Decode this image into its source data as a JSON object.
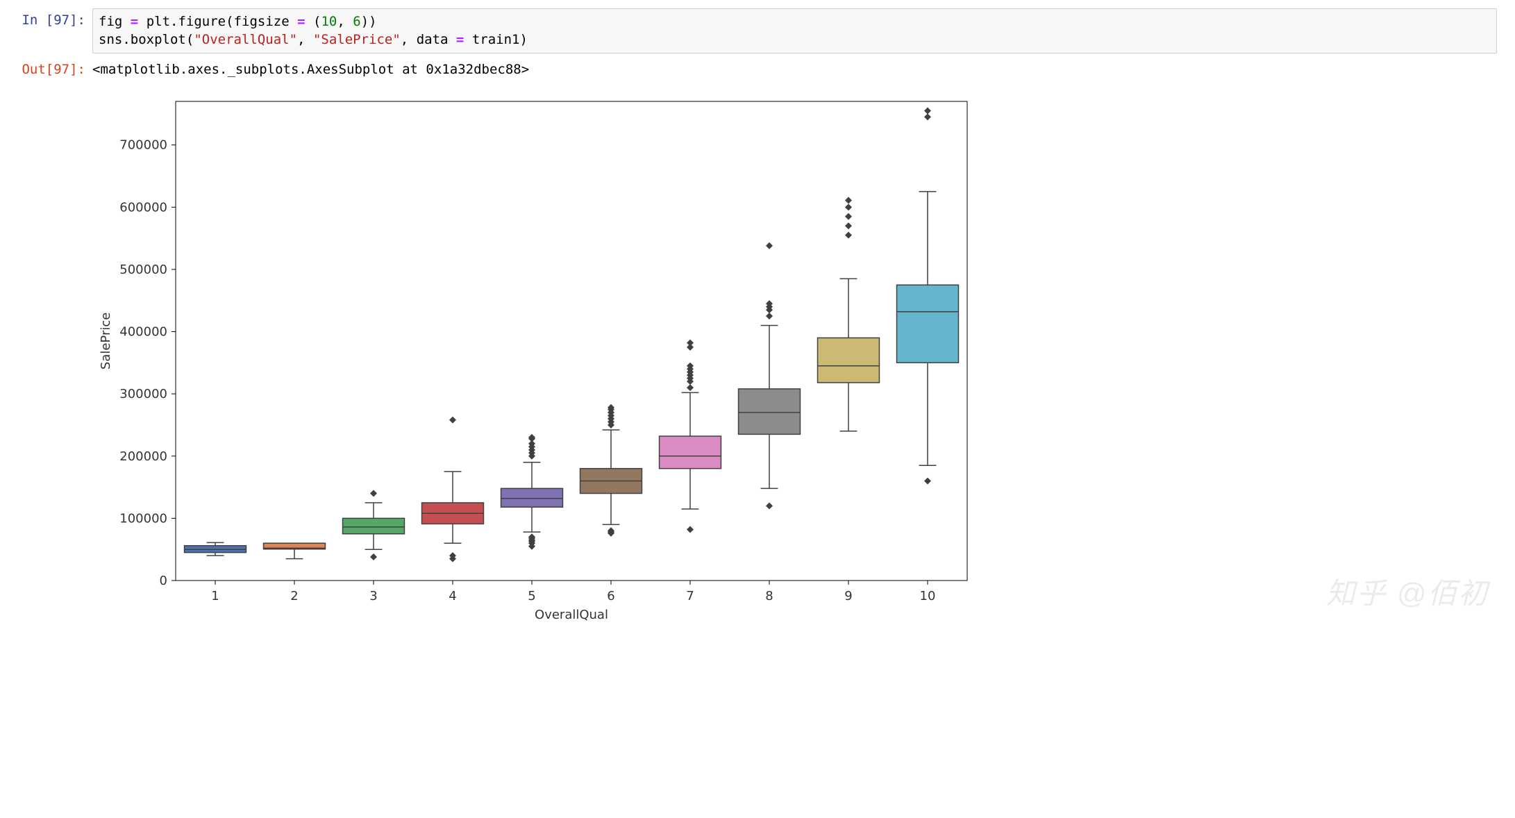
{
  "input_prompt": "In [97]:",
  "output_prompt": "Out[97]:",
  "code_line1_tokens": {
    "fig": "fig",
    "eq": "=",
    "plt": "plt",
    "dot1": ".",
    "figure": "figure",
    "lp": "(",
    "figsize": "figsize",
    "eq2": "=",
    "lp2": "(",
    "ten": "10",
    "comma": ",",
    "six": "6",
    "rp2": ")",
    "rp": ")"
  },
  "code_line2_tokens": {
    "sns": "sns",
    "dot": ".",
    "boxplot": "boxplot",
    "lp": "(",
    "s1": "\"OverallQual\"",
    "comma1": ",",
    "s2": "\"SalePrice\"",
    "comma2": ",",
    "data": "data",
    "eq": "=",
    "train": "train1",
    "rp": ")"
  },
  "output_text": "<matplotlib.axes._subplots.AxesSubplot at 0x1a32dbec88>",
  "watermark": "知乎 @佰初",
  "chart_data": {
    "type": "box",
    "xlabel": "OverallQual",
    "ylabel": "SalePrice",
    "categories": [
      "1",
      "2",
      "3",
      "4",
      "5",
      "6",
      "7",
      "8",
      "9",
      "10"
    ],
    "ylim": [
      0,
      770000
    ],
    "yticks": [
      0,
      100000,
      200000,
      300000,
      400000,
      500000,
      600000,
      700000
    ],
    "ytick_labels": [
      "0",
      "100000",
      "200000",
      "300000",
      "400000",
      "500000",
      "600000",
      "700000"
    ],
    "series": [
      {
        "cat": "1",
        "color": "#4c72b0",
        "q1": 45000,
        "median": 50000,
        "q3": 56000,
        "wlo": 40000,
        "whi": 61000,
        "outliers": []
      },
      {
        "cat": "2",
        "color": "#dd8452",
        "q1": 50500,
        "median": 52000,
        "q3": 60000,
        "wlo": 35000,
        "whi": 60000,
        "outliers": []
      },
      {
        "cat": "3",
        "color": "#55a868",
        "q1": 75000,
        "median": 86000,
        "q3": 100000,
        "wlo": 50000,
        "whi": 125000,
        "outliers": [
          38000,
          140000
        ]
      },
      {
        "cat": "4",
        "color": "#c44e52",
        "q1": 91000,
        "median": 108000,
        "q3": 125000,
        "wlo": 60000,
        "whi": 175000,
        "outliers": [
          35000,
          40000,
          258000
        ]
      },
      {
        "cat": "5",
        "color": "#8172b3",
        "q1": 118000,
        "median": 132000,
        "q3": 148000,
        "wlo": 78000,
        "whi": 190000,
        "outliers": [
          55000,
          60000,
          63000,
          65000,
          68000,
          70000,
          200000,
          205000,
          210000,
          215000,
          220000,
          228000,
          230000
        ]
      },
      {
        "cat": "6",
        "color": "#937860",
        "q1": 140000,
        "median": 160000,
        "q3": 180000,
        "wlo": 90000,
        "whi": 242000,
        "outliers": [
          76000,
          78000,
          80000,
          250000,
          255000,
          260000,
          265000,
          270000,
          275000,
          278000
        ]
      },
      {
        "cat": "7",
        "color": "#da8bc3",
        "q1": 180000,
        "median": 200000,
        "q3": 232000,
        "wlo": 115000,
        "whi": 302000,
        "outliers": [
          82000,
          310000,
          320000,
          325000,
          330000,
          335000,
          340000,
          345000,
          375000,
          382000
        ]
      },
      {
        "cat": "8",
        "color": "#8c8c8c",
        "q1": 235000,
        "median": 270000,
        "q3": 308000,
        "wlo": 148000,
        "whi": 410000,
        "outliers": [
          120000,
          425000,
          435000,
          440000,
          445000,
          538000
        ]
      },
      {
        "cat": "9",
        "color": "#ccb974",
        "q1": 318000,
        "median": 345000,
        "q3": 390000,
        "wlo": 240000,
        "whi": 485000,
        "outliers": [
          555000,
          570000,
          585000,
          600000,
          611000
        ]
      },
      {
        "cat": "10",
        "color": "#64b5cd",
        "q1": 350000,
        "median": 432000,
        "q3": 475000,
        "wlo": 185000,
        "whi": 625000,
        "outliers": [
          160000,
          745000,
          755000
        ]
      }
    ]
  }
}
